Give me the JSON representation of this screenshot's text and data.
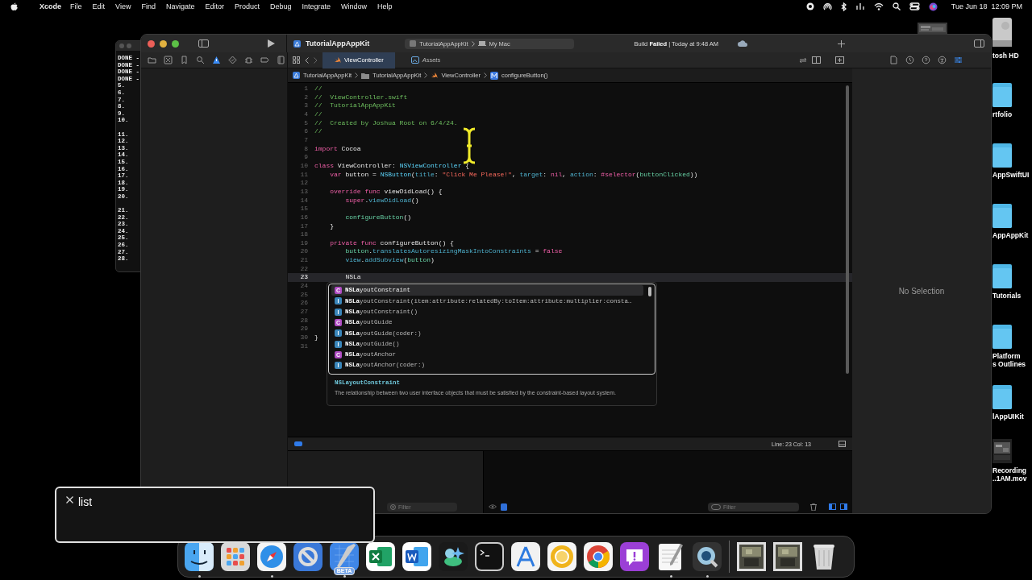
{
  "menubar": {
    "app": "Xcode",
    "menus": [
      "File",
      "Edit",
      "View",
      "Find",
      "Navigate",
      "Editor",
      "Product",
      "Debug",
      "Integrate",
      "Window",
      "Help"
    ],
    "clock": "Tue Jun 18  12:09 PM"
  },
  "desktop_items": [
    {
      "kind": "drive",
      "lines": [
        "tosh HD"
      ]
    },
    {
      "kind": "folder",
      "lines": [
        "rtfolio"
      ]
    },
    {
      "kind": "folder",
      "lines": [
        "AppSwiftUI"
      ]
    },
    {
      "kind": "folder",
      "lines": [
        "AppAppKit"
      ]
    },
    {
      "kind": "folder",
      "lines": [
        "Tutorials"
      ]
    },
    {
      "kind": "folder",
      "lines": [
        "Platform",
        "s Outlines"
      ]
    },
    {
      "kind": "folder",
      "lines": [
        "lAppUIKit"
      ]
    },
    {
      "kind": "movie",
      "lines": [
        "Recording",
        "..1AM.mov"
      ]
    }
  ],
  "terminal": {
    "groups": [
      [
        "DONE -",
        "DONE -",
        "DONE -",
        "DONE -",
        "5.",
        "6.",
        "7.",
        "8.",
        "9.",
        "10."
      ],
      [
        "11.",
        "12.",
        "13.",
        "14.",
        "15.",
        "16.",
        "17.",
        "18.",
        "19.",
        "20."
      ],
      [
        "21.",
        "22.",
        "23.",
        "24.",
        "25.",
        "26.",
        "27.",
        "28."
      ]
    ]
  },
  "xcode": {
    "project_title": "TutorialAppAppKit",
    "scheme": {
      "target": "TutorialAppAppKit",
      "destination": "My Mac"
    },
    "build_status": "Build **Failed** | Today at 9:48 AM",
    "navigator_tabs": [
      {
        "kind": "folder",
        "selected": false
      },
      {
        "kind": "source-control",
        "selected": false
      },
      {
        "kind": "bookmark",
        "selected": false
      },
      {
        "kind": "search",
        "selected": false
      },
      {
        "kind": "issue",
        "selected": true
      },
      {
        "kind": "test",
        "selected": false
      },
      {
        "kind": "debug",
        "selected": false
      },
      {
        "kind": "breakpoint",
        "selected": false
      },
      {
        "kind": "report",
        "selected": false
      }
    ],
    "editor_tabs": [
      {
        "label": "ViewController",
        "kind": "swift",
        "selected": true,
        "preview": false
      },
      {
        "label": "Assets",
        "kind": "assets",
        "selected": false,
        "preview": true
      }
    ],
    "breadcrumb": [
      {
        "label": "TutorialAppAppKit",
        "kind": "project"
      },
      {
        "label": "TutorialAppAppKit",
        "kind": "folder"
      },
      {
        "label": "ViewController",
        "kind": "swift"
      },
      {
        "label": "configureButton()",
        "kind": "method"
      }
    ],
    "inspector_tabs": [
      {
        "kind": "file",
        "selected": false
      },
      {
        "kind": "history",
        "selected": false
      },
      {
        "kind": "help",
        "selected": false
      },
      {
        "kind": "accessibility",
        "selected": false
      },
      {
        "kind": "attributes",
        "selected": true
      }
    ],
    "code_lines": [
      {
        "n": "1",
        "tokens": [
          {
            "kind": "comment",
            "text": "//"
          }
        ]
      },
      {
        "n": "2",
        "tokens": [
          {
            "kind": "comment",
            "text": "//  ViewController.swift"
          }
        ]
      },
      {
        "n": "3",
        "tokens": [
          {
            "kind": "comment",
            "text": "//  TutorialAppAppKit"
          }
        ]
      },
      {
        "n": "4",
        "tokens": [
          {
            "kind": "comment",
            "text": "//"
          }
        ]
      },
      {
        "n": "5",
        "tokens": [
          {
            "kind": "comment",
            "text": "//  Created by Joshua Root on 6/4/24."
          }
        ]
      },
      {
        "n": "6",
        "tokens": [
          {
            "kind": "comment",
            "text": "//"
          }
        ]
      },
      {
        "n": "7"
      },
      {
        "n": "8",
        "tokens": [
          {
            "kind": "keyword",
            "text": "import"
          },
          {
            "kind": "plain",
            "text": " Cocoa"
          }
        ]
      },
      {
        "n": "9"
      },
      {
        "n": "10",
        "tokens": [
          {
            "kind": "keyword",
            "text": "class"
          },
          {
            "kind": "plain",
            "text": " ViewController: "
          },
          {
            "kind": "type",
            "text": "NSViewController"
          },
          {
            "kind": "plain",
            "text": " {"
          }
        ]
      },
      {
        "n": "11",
        "tokens": [
          {
            "kind": "keyword",
            "text": "    var"
          },
          {
            "kind": "plain",
            "text": " button = "
          },
          {
            "kind": "type",
            "text": "NSButton"
          },
          {
            "kind": "plain",
            "text": "("
          },
          {
            "kind": "member",
            "text": "title"
          },
          {
            "kind": "plain",
            "text": ": "
          },
          {
            "kind": "string",
            "text": "\"Click Me Please!\""
          },
          {
            "kind": "plain",
            "text": ", "
          },
          {
            "kind": "member",
            "text": "target"
          },
          {
            "kind": "plain",
            "text": ": "
          },
          {
            "kind": "keyword",
            "text": "nil"
          },
          {
            "kind": "plain",
            "text": ", "
          },
          {
            "kind": "member",
            "text": "action"
          },
          {
            "kind": "plain",
            "text": ": "
          },
          {
            "kind": "keyword",
            "text": "#selector"
          },
          {
            "kind": "plain",
            "text": "("
          },
          {
            "kind": "project",
            "text": "buttonClicked"
          },
          {
            "kind": "plain",
            "text": "))"
          }
        ]
      },
      {
        "n": "12"
      },
      {
        "n": "13",
        "tokens": [
          {
            "kind": "keyword",
            "text": "    override func"
          },
          {
            "kind": "plain",
            "text": " viewDidLoad() {"
          }
        ]
      },
      {
        "n": "14",
        "tokens": [
          {
            "kind": "keyword",
            "text": "        super"
          },
          {
            "kind": "plain",
            "text": "."
          },
          {
            "kind": "member",
            "text": "viewDidLoad"
          },
          {
            "kind": "plain",
            "text": "()"
          }
        ]
      },
      {
        "n": "15"
      },
      {
        "n": "16",
        "tokens": [
          {
            "kind": "project",
            "text": "        configureButton"
          },
          {
            "kind": "plain",
            "text": "()"
          }
        ]
      },
      {
        "n": "17",
        "tokens": [
          {
            "kind": "plain",
            "text": "    }"
          }
        ]
      },
      {
        "n": "18"
      },
      {
        "n": "19",
        "tokens": [
          {
            "kind": "keyword",
            "text": "    private func"
          },
          {
            "kind": "plain",
            "text": " configureButton() {"
          }
        ]
      },
      {
        "n": "20",
        "tokens": [
          {
            "kind": "project",
            "text": "        button"
          },
          {
            "kind": "plain",
            "text": "."
          },
          {
            "kind": "member",
            "text": "translatesAutoresizingMaskIntoConstraints"
          },
          {
            "kind": "plain",
            "text": " = "
          },
          {
            "kind": "keyword",
            "text": "false"
          }
        ]
      },
      {
        "n": "21",
        "tokens": [
          {
            "kind": "member",
            "text": "        view"
          },
          {
            "kind": "plain",
            "text": "."
          },
          {
            "kind": "member",
            "text": "addSubview"
          },
          {
            "kind": "plain",
            "text": "("
          },
          {
            "kind": "project",
            "text": "button"
          },
          {
            "kind": "plain",
            "text": ")"
          }
        ]
      },
      {
        "n": "22"
      },
      {
        "n": "23",
        "current": true,
        "tokens": [
          {
            "kind": "plain",
            "text": "        NSLa"
          }
        ]
      },
      {
        "n": "24"
      },
      {
        "n": "25"
      },
      {
        "n": "26"
      },
      {
        "n": "27"
      },
      {
        "n": "28"
      },
      {
        "n": "29"
      },
      {
        "n": "30",
        "tokens": [
          {
            "kind": "plain",
            "text": "}"
          }
        ]
      },
      {
        "n": "31"
      }
    ],
    "completion": {
      "items": [
        {
          "kind": "class",
          "badge": "C",
          "label": "**NSLa**youtConstraint",
          "selected": true
        },
        {
          "kind": "init",
          "badge": "I",
          "label": "**NSLa**youtConstraint(item:attribute:relatedBy:toItem:attribute:multiplier:consta…",
          "selected": false
        },
        {
          "kind": "init",
          "badge": "I",
          "label": "**NSLa**youtConstraint()",
          "selected": false
        },
        {
          "kind": "class",
          "badge": "C",
          "label": "**NSLa**youtGuide",
          "selected": false
        },
        {
          "kind": "init",
          "badge": "I",
          "label": "**NSLa**youtGuide(coder:)",
          "selected": false
        },
        {
          "kind": "init",
          "badge": "I",
          "label": "**NSLa**youtGuide()",
          "selected": false
        },
        {
          "kind": "class",
          "badge": "C",
          "label": "**NSLa**youtAnchor",
          "selected": false
        },
        {
          "kind": "init",
          "badge": "I",
          "label": "**NSLa**youtAnchor(coder:)",
          "selected": false
        }
      ],
      "detail_title": "NSLayoutConstraint",
      "detail_text": "The relationship between two user interface objects that must be satisfied by the constraint-based layout system."
    },
    "cursor_position": "Line: 23  Col: 13",
    "debug_filters": [
      {
        "placeholder": "Filter"
      },
      {
        "placeholder": "Filter"
      }
    ],
    "inspector_message": "No Selection"
  },
  "keystroke_overlay": {
    "text": "list"
  },
  "dock": {
    "items": [
      {
        "kind": "finder",
        "running": true
      },
      {
        "kind": "launchpad",
        "running": false
      },
      {
        "kind": "safari",
        "running": true
      },
      {
        "kind": "prohibited",
        "running": false
      },
      {
        "kind": "xcode",
        "running": true,
        "badge": "BETA"
      },
      {
        "kind": "excel",
        "running": false
      },
      {
        "kind": "word",
        "running": false
      },
      {
        "kind": "green-app",
        "running": false
      },
      {
        "kind": "terminal",
        "running": false
      },
      {
        "kind": "a-tool",
        "running": false
      },
      {
        "kind": "yellow-ring",
        "running": false
      },
      {
        "kind": "chrome",
        "running": false
      },
      {
        "kind": "feedback",
        "running": false
      },
      {
        "kind": "notepad",
        "running": true
      },
      {
        "kind": "quicktime",
        "running": true
      },
      {
        "kind": "separator"
      },
      {
        "kind": "thumbnail",
        "running": false
      },
      {
        "kind": "thumbnail",
        "running": false
      },
      {
        "kind": "trash",
        "running": false
      }
    ]
  }
}
